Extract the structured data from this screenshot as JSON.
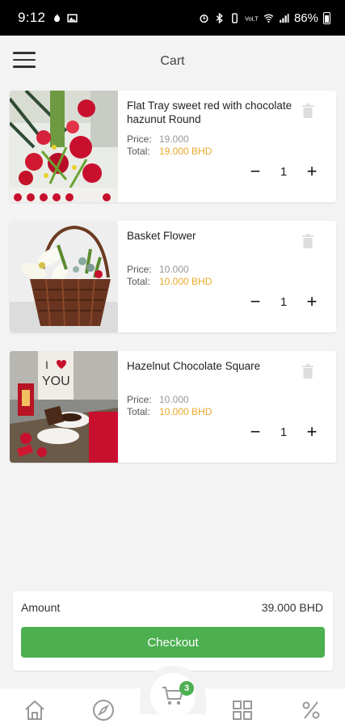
{
  "status_bar": {
    "time": "9:12",
    "battery": "86%"
  },
  "header": {
    "title": "Cart"
  },
  "cart": {
    "price_label": "Price:",
    "total_label": "Total:",
    "items": [
      {
        "name": "Flat Tray sweet red  with chocolate hazunut Round",
        "price": "19.000",
        "total": "19.000 BHD",
        "qty": "1"
      },
      {
        "name": "Basket Flower",
        "price": "10.000",
        "total": "10.000 BHD",
        "qty": "1"
      },
      {
        "name": "Hazelnut Chocolate Square",
        "price": "10.000",
        "total": "10.000 BHD",
        "qty": "1"
      }
    ]
  },
  "summary": {
    "amount_label": "Amount",
    "amount_value": "39.000 BHD",
    "checkout_label": "Checkout"
  },
  "bottom_nav": {
    "cart_badge": "3",
    "items": [
      "home-icon",
      "compass-icon",
      "cart-icon",
      "grid-icon",
      "percent-icon"
    ]
  },
  "colors": {
    "accent_green": "#4caf50",
    "total_orange": "#e9a92a"
  }
}
